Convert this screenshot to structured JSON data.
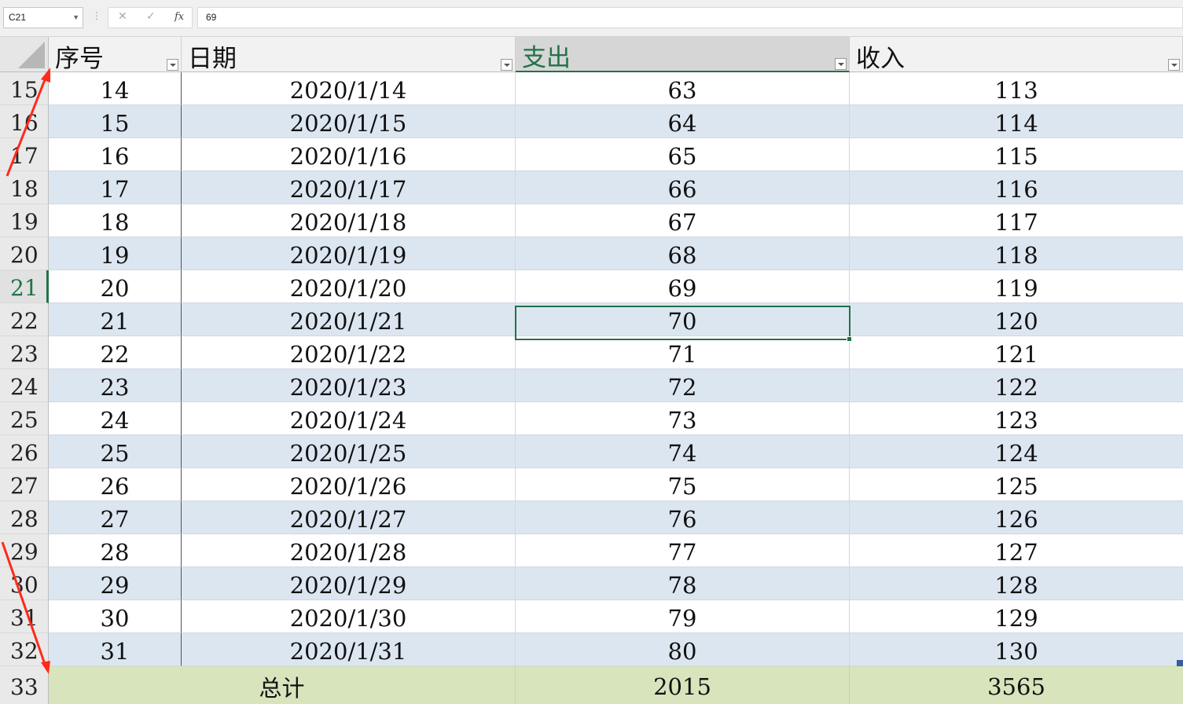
{
  "formula_bar": {
    "name_box": "C21",
    "cancel_icon": "✕",
    "enter_icon": "✓",
    "fx_label": "fx",
    "formula": "69"
  },
  "columns": [
    "序号",
    "日期",
    "支出",
    "收入"
  ],
  "rows": [
    {
      "rn": "15",
      "seq": "14",
      "date": "2020/1/14",
      "out": "63",
      "in": "113"
    },
    {
      "rn": "16",
      "seq": "15",
      "date": "2020/1/15",
      "out": "64",
      "in": "114"
    },
    {
      "rn": "17",
      "seq": "16",
      "date": "2020/1/16",
      "out": "65",
      "in": "115"
    },
    {
      "rn": "18",
      "seq": "17",
      "date": "2020/1/17",
      "out": "66",
      "in": "116"
    },
    {
      "rn": "19",
      "seq": "18",
      "date": "2020/1/18",
      "out": "67",
      "in": "117"
    },
    {
      "rn": "20",
      "seq": "19",
      "date": "2020/1/19",
      "out": "68",
      "in": "118"
    },
    {
      "rn": "21",
      "seq": "20",
      "date": "2020/1/20",
      "out": "69",
      "in": "119"
    },
    {
      "rn": "22",
      "seq": "21",
      "date": "2020/1/21",
      "out": "70",
      "in": "120"
    },
    {
      "rn": "23",
      "seq": "22",
      "date": "2020/1/22",
      "out": "71",
      "in": "121"
    },
    {
      "rn": "24",
      "seq": "23",
      "date": "2020/1/23",
      "out": "72",
      "in": "122"
    },
    {
      "rn": "25",
      "seq": "24",
      "date": "2020/1/24",
      "out": "73",
      "in": "123"
    },
    {
      "rn": "26",
      "seq": "25",
      "date": "2020/1/25",
      "out": "74",
      "in": "124"
    },
    {
      "rn": "27",
      "seq": "26",
      "date": "2020/1/26",
      "out": "75",
      "in": "125"
    },
    {
      "rn": "28",
      "seq": "27",
      "date": "2020/1/27",
      "out": "76",
      "in": "126"
    },
    {
      "rn": "29",
      "seq": "28",
      "date": "2020/1/28",
      "out": "77",
      "in": "127"
    },
    {
      "rn": "30",
      "seq": "29",
      "date": "2020/1/29",
      "out": "78",
      "in": "128"
    },
    {
      "rn": "31",
      "seq": "30",
      "date": "2020/1/30",
      "out": "79",
      "in": "129"
    },
    {
      "rn": "32",
      "seq": "31",
      "date": "2020/1/31",
      "out": "80",
      "in": "130"
    }
  ],
  "total": {
    "rn": "33",
    "label": "总计",
    "out": "2015",
    "in": "3565"
  },
  "colors": {
    "accent": "#217346",
    "band": "#dce6f1",
    "total_fill": "#d8e4bc",
    "arrow": "#ff2a1a"
  }
}
